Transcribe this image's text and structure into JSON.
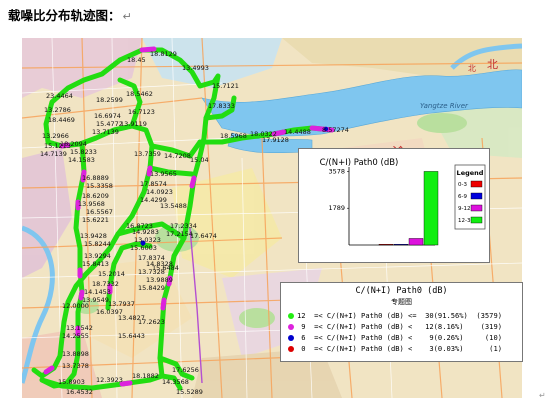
{
  "doc": {
    "title": "载噪比分布轨迹图：",
    "para_mark": "↵",
    "end_mark": "↵"
  },
  "map": {
    "river_label": "Yangtze River",
    "north_label": "北",
    "district_labels": [
      "渝",
      "北",
      "南"
    ],
    "track_colors": {
      "12-30": "#22dd11",
      "9-12": "#dd22dd",
      "6-9": "#0000cc",
      "0-3": "#dd0000"
    },
    "point_labels": [
      "18.45",
      "18.8129",
      "13.4993",
      "15.7121",
      "17.8333",
      "23.4464",
      "18.2599",
      "18.5462",
      "16.7123",
      "13.9119",
      "13.2786",
      "18.4469",
      "16.6974",
      "15.4772",
      "13.7139",
      "13.2966",
      "15.1213",
      "18.2094",
      "14.7139",
      "15.8233",
      "14.1583",
      "13.7359",
      "14.7208",
      "15.04",
      "13.9565",
      "16.8889",
      "15.3358",
      "17.8574",
      "14.0923",
      "14.4299",
      "18.6209",
      "13.9568",
      "16.5567",
      "15.6221",
      "16.8723",
      "14.9283",
      "13.9428",
      "15.8244",
      "17.2334",
      "17.2154",
      "13.0323",
      "15.6003",
      "17.8374",
      "14.8328",
      "13.5488",
      "13.9294",
      "15.8413",
      "15.2014",
      "17.6474",
      "15.6484",
      "13.7328",
      "18.7332",
      "14.1453",
      "13.9889",
      "15.8429",
      "13.9549",
      "12.0000",
      "13.7937",
      "16.0397",
      "13.4827",
      "13.1542",
      "17.2623",
      "14.2555",
      "15.6443",
      "13.8898",
      "13.7378",
      "12.3923",
      "18.1882",
      "14.3568",
      "15.5289",
      "17.6256",
      "16.4532",
      "15.8903"
    ],
    "east_labels": [
      "18.5968",
      "18.0322",
      "17.9128",
      "14.4488",
      "8.57274"
    ]
  },
  "chart_data": {
    "type": "bar",
    "title": "C/(N+I) Path0 (dB)",
    "categories": [
      "0-3",
      "6-9",
      "9-12",
      "12-30"
    ],
    "values": [
      1,
      10,
      319,
      3579
    ],
    "colors": [
      "#ee0000",
      "#0000dd",
      "#dd11dd",
      "#11ee11"
    ],
    "yticks": [
      1789,
      3578
    ],
    "ylim": [
      0,
      3600
    ],
    "legend_title": "Legend",
    "legend_labels": [
      "0-3",
      "6-9",
      "9-12",
      "12-30"
    ],
    "legend_position": "right"
  },
  "legend_panel": {
    "title": "C/(N+I) Path0 (dB)",
    "subtitle": "专题图",
    "rows": [
      {
        "color": "#22ee11",
        "text": "12  =< C/(N+I) Path0 (dB) <=  30(91.56%)  (3579)"
      },
      {
        "color": "#dd22dd",
        "text": " 9  =< C/(N+I) Path0 (dB) <   12(8.16%)    (319)"
      },
      {
        "color": "#0000cc",
        "text": " 6  =< C/(N+I) Path0 (dB) <    9(0.26%)     (10)"
      },
      {
        "color": "#dd0000",
        "text": " 0  =< C/(N+I) Path0 (dB) <    3(0.03%)      (1)"
      }
    ]
  }
}
